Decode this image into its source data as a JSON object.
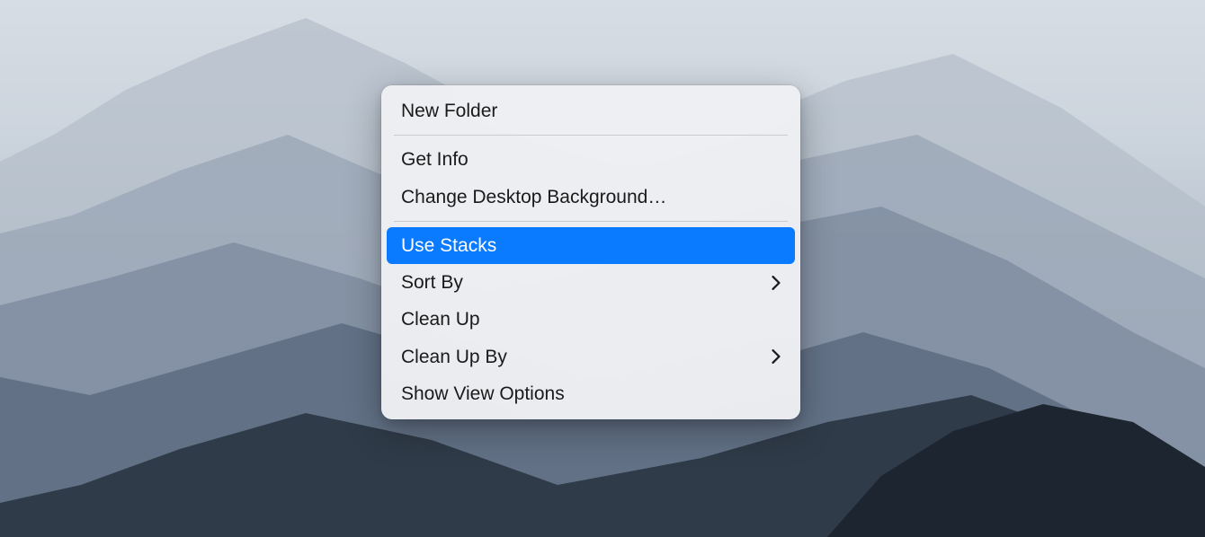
{
  "menu": {
    "items": [
      {
        "label": "New Folder",
        "submenu": false
      },
      {
        "separator": true
      },
      {
        "label": "Get Info",
        "submenu": false
      },
      {
        "label": "Change Desktop Background…",
        "submenu": false
      },
      {
        "separator": true
      },
      {
        "label": "Use Stacks",
        "submenu": false,
        "highlighted": true
      },
      {
        "label": "Sort By",
        "submenu": true
      },
      {
        "label": "Clean Up",
        "submenu": false
      },
      {
        "label": "Clean Up By",
        "submenu": true
      },
      {
        "label": "Show View Options",
        "submenu": false
      }
    ]
  },
  "colors": {
    "highlight": "#0a7aff",
    "menu_bg": "#eef0f3",
    "text": "#1a1a1a"
  }
}
